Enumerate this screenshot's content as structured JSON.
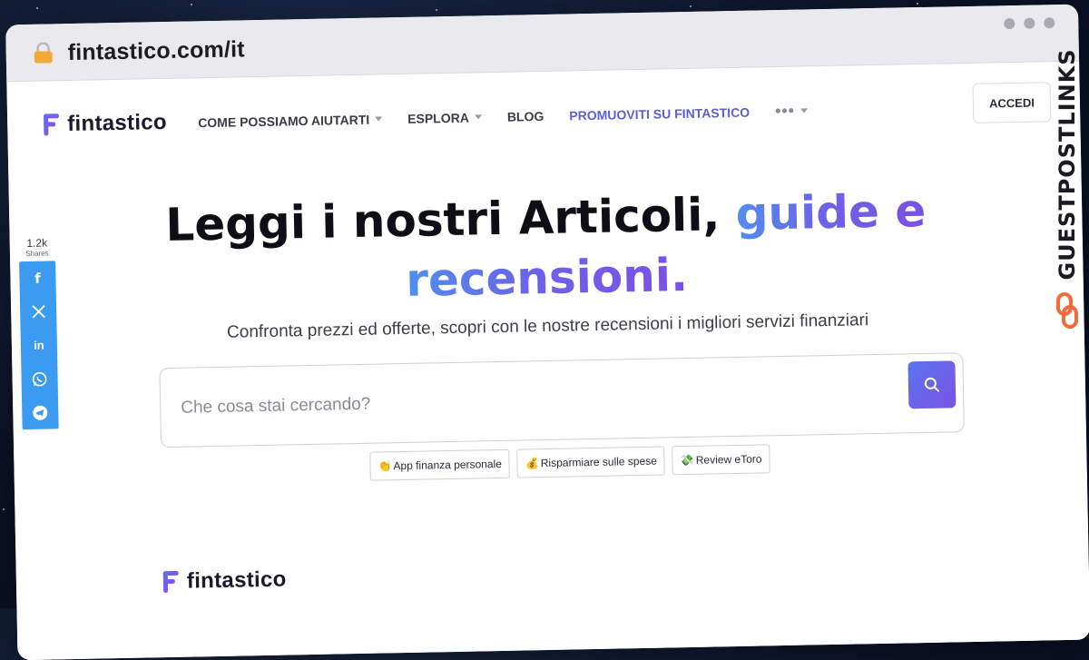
{
  "browser": {
    "url": "fintastico.com/it"
  },
  "nav": {
    "logo_text": "fintastico",
    "items": [
      {
        "label": "COME POSSIAMO AIUTARTI",
        "has_dropdown": true
      },
      {
        "label": "ESPLORA",
        "has_dropdown": true
      },
      {
        "label": "BLOG",
        "has_dropdown": false
      },
      {
        "label": "PROMUOVITI SU FINTASTICO",
        "has_dropdown": false
      }
    ],
    "more_label": "•••",
    "login_label": "ACCEDI"
  },
  "hero": {
    "title_plain": "Leggi i nostri Articoli, ",
    "title_highlight_1": "guide e",
    "title_highlight_2": "recensioni.",
    "subtitle": "Confronta prezzi ed offerte, scopri con le nostre recensioni i migliori servizi finanziari"
  },
  "search": {
    "placeholder": "Che cosa stai cercando?"
  },
  "chips": [
    {
      "emoji": "👏",
      "label": "App finanza personale"
    },
    {
      "emoji": "💰",
      "label": "Risparmiare sulle spese"
    },
    {
      "emoji": "💸",
      "label": "Review eToro"
    }
  ],
  "share": {
    "count": "1.2k",
    "label": "Shares"
  },
  "footer": {
    "logo_text": "fintastico"
  },
  "watermark": {
    "text": "GUESTPOSTLINKS"
  },
  "colors": {
    "brand_purple": "#5b5fd6",
    "gradient_start": "#4f8ff0",
    "gradient_end": "#7d4fe6",
    "share_blue": "#3b9bf0"
  }
}
